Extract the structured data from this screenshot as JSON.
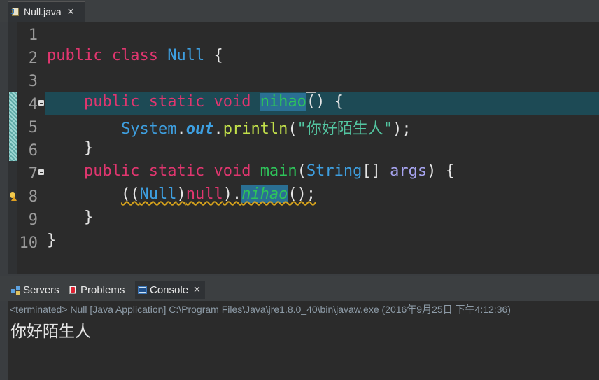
{
  "editor": {
    "tab": {
      "title": "Null.java",
      "close": "✕",
      "icon": "java-file-icon"
    },
    "line_numbers": [
      "1",
      "2",
      "3",
      "4",
      "5",
      "6",
      "7",
      "8",
      "9",
      "10"
    ],
    "code": {
      "l2": {
        "kw1": "public",
        "kw2": "class",
        "cls": "Null",
        "rest": " {"
      },
      "l4": {
        "indent": "    ",
        "kw1": "public",
        "kw2": "static",
        "kw3": "void",
        "meth": "nihao",
        "paren1": "(",
        "paren2": ")",
        "rest": " {"
      },
      "l5": {
        "indent": "        ",
        "sys": "System",
        "dot1": ".",
        "out": "out",
        "dot2": ".",
        "println": "println",
        "open": "(",
        "str": "\"你好陌生人\"",
        "close": ");"
      },
      "l6": {
        "text": "    }"
      },
      "l7": {
        "indent": "    ",
        "kw1": "public",
        "kw2": "static",
        "kw3": "void",
        "meth": "main",
        "open": "(",
        "type": "String",
        "arr": "[] ",
        "param": "args",
        "rest": ") {"
      },
      "l8": {
        "indent": "        ",
        "p1": "((",
        "cls": "Null",
        "p2": ")",
        "kwnull": "null",
        "p3": ").",
        "meth": "nihao",
        "rest": "();"
      },
      "l9": {
        "text": "    }"
      },
      "l10": {
        "text": "}"
      }
    }
  },
  "views": {
    "tabs": [
      {
        "label": "Servers",
        "icon": "servers-icon"
      },
      {
        "label": "Problems",
        "icon": "problems-icon"
      },
      {
        "label": "Console",
        "icon": "console-icon",
        "active": true,
        "close": "✕"
      }
    ]
  },
  "console": {
    "status": "<terminated> Null [Java Application] C:\\Program Files\\Java\\jre1.8.0_40\\bin\\javaw.exe (2016年9月25日 下午4:12:36)",
    "output": "你好陌生人"
  },
  "colors": {
    "keyword": "#e0366f",
    "class": "#3e9fe0",
    "method": "#2ec55a",
    "string": "#53c5a1",
    "current_line": "#1d4a55"
  }
}
